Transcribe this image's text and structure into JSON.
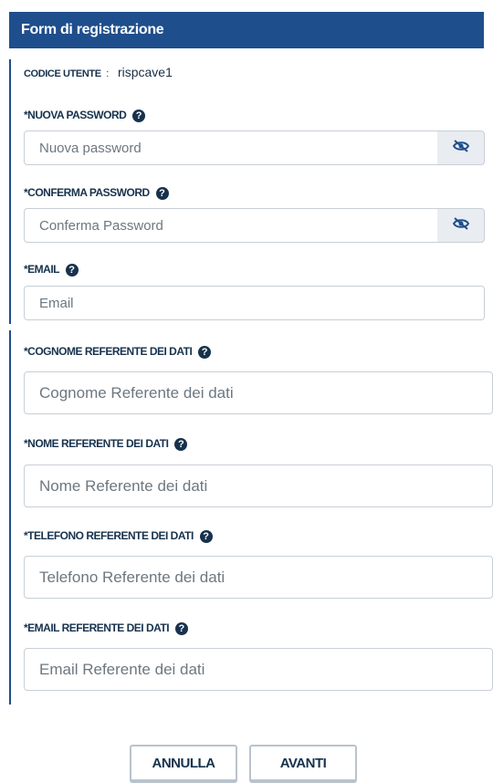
{
  "form": {
    "title": "Form di registrazione",
    "user_code_label": "CODICE UTENTE",
    "user_code_separator": ":",
    "user_code_value": "rispcave1"
  },
  "fields": {
    "new_password": {
      "label": "*NUOVA PASSWORD",
      "placeholder": "Nuova password",
      "value": ""
    },
    "confirm_password": {
      "label": "*CONFERMA PASSWORD",
      "placeholder": "Conferma Password",
      "value": ""
    },
    "email": {
      "label": "*EMAIL",
      "placeholder": "Email",
      "value": ""
    },
    "referent_surname": {
      "label": "*COGNOME REFERENTE DEI DATI",
      "placeholder": "Cognome Referente dei dati",
      "value": ""
    },
    "referent_name": {
      "label": "*NOME REFERENTE DEI DATI",
      "placeholder": "Nome Referente dei dati",
      "value": ""
    },
    "referent_phone": {
      "label": "*TELEFONO REFERENTE DEI DATI",
      "placeholder": "Telefono Referente dei dati",
      "value": ""
    },
    "referent_email": {
      "label": "*EMAIL REFERENTE DEI DATI",
      "placeholder": "Email Referente dei dati",
      "value": ""
    }
  },
  "buttons": {
    "cancel": "ANNULLA",
    "next": "AVANTI"
  },
  "icons": {
    "help": "question-circle-icon",
    "toggle_visibility": "eye-slash-icon"
  },
  "colors": {
    "header_background": "#1f4e8c",
    "text_primary": "#17324d",
    "input_border": "#c8cfd6",
    "eye_button_background": "#e9edf1"
  }
}
